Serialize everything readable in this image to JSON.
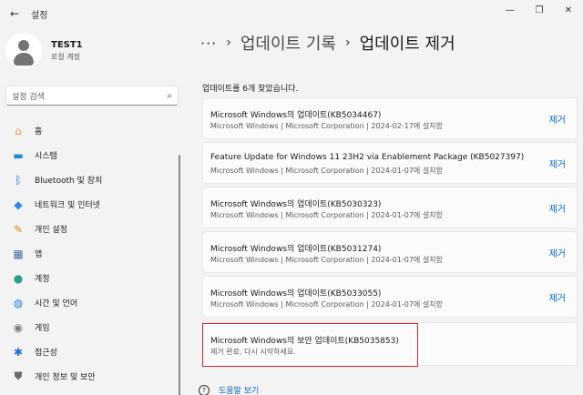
{
  "window": {
    "title": "설정",
    "controls": {
      "minimize": "—",
      "restore": "❐",
      "close": "✕"
    }
  },
  "account": {
    "name": "TEST1",
    "type": "로컬 계정"
  },
  "search": {
    "placeholder": "설정 검색"
  },
  "sidebar": {
    "items": [
      {
        "label": "홈",
        "icon": "home-icon",
        "glyph": "⌂",
        "color": "#e8a23a"
      },
      {
        "label": "시스템",
        "icon": "monitor-icon",
        "glyph": "▬",
        "color": "#1a8fd9"
      },
      {
        "label": "Bluetooth 및 장치",
        "icon": "bluetooth-icon",
        "glyph": "ᛒ",
        "color": "#1a73d9"
      },
      {
        "label": "네트워크 및 인터넷",
        "icon": "wifi-icon",
        "glyph": "◆",
        "color": "#2b8be6"
      },
      {
        "label": "개인 설정",
        "icon": "brush-icon",
        "glyph": "✎",
        "color": "#d9822b"
      },
      {
        "label": "앱",
        "icon": "apps-icon",
        "glyph": "▦",
        "color": "#4a6fa5"
      },
      {
        "label": "계정",
        "icon": "person-icon",
        "glyph": "●",
        "color": "#27a28a"
      },
      {
        "label": "시간 및 언어",
        "icon": "globe-clock-icon",
        "glyph": "◍",
        "color": "#2a7fd4"
      },
      {
        "label": "게임",
        "icon": "gamepad-icon",
        "glyph": "◉",
        "color": "#7a7a7a"
      },
      {
        "label": "접근성",
        "icon": "accessibility-icon",
        "glyph": "✱",
        "color": "#1f6fd1"
      },
      {
        "label": "개인 정보 및 보안",
        "icon": "shield-icon",
        "glyph": "⛊",
        "color": "#6a6a6a"
      }
    ]
  },
  "breadcrumb": {
    "more": "···",
    "separator": "›",
    "parent": "업데이트 기록",
    "current": "업데이트 제거"
  },
  "summary": "업데이트를 6개 찾았습니다.",
  "remove_label": "제거",
  "updates": [
    {
      "title": "Microsoft Windows의 업데이트(KB5034467)",
      "meta": "Microsoft Windows  |  Microsoft Corporation  |  2024-02-17에 설치함"
    },
    {
      "title": "Feature Update for Windows 11 23H2 via Enablement Package (KB5027397)",
      "meta": "Microsoft Windows  |  Microsoft Corporation  |  2024-01-07에 설치함"
    },
    {
      "title": "Microsoft Windows의 업데이트(KB5030323)",
      "meta": "Microsoft Windows  |  Microsoft Corporation  |  2024-01-07에 설치함"
    },
    {
      "title": "Microsoft Windows의 업데이트(KB5031274)",
      "meta": "Microsoft Windows  |  Microsoft Corporation  |  2024-01-07에 설치함"
    },
    {
      "title": "Microsoft Windows의 업데이트(KB5033055)",
      "meta": "Microsoft Windows  |  Microsoft Corporation  |  2024-01-07에 설치함"
    }
  ],
  "removed_update": {
    "title": "Microsoft Windows의 보안 업데이트(KB5035853)",
    "status": "제거 완료, 다시 시작하세요."
  },
  "help": {
    "label": "도움말 보기",
    "icon": "help-icon"
  },
  "colors": {
    "accent": "#0067c0",
    "highlight_border": "#d6262f"
  }
}
